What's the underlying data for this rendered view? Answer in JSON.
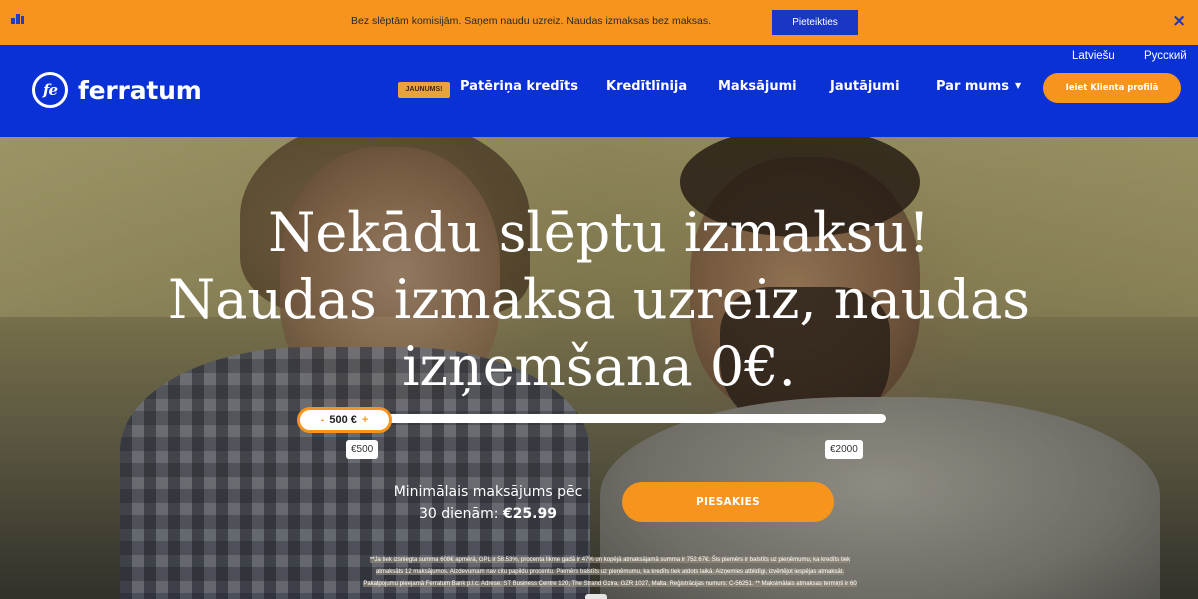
{
  "promo_bar": {
    "text": "Bez slēptām komisijām. Saņem naudu uzreiz. Naudas izmaksas bez maksas.",
    "button": "Pieteikties",
    "close": "×"
  },
  "header": {
    "logo_mark": "fe",
    "logo_text": "ferratum",
    "languages": [
      "Latviešu",
      "Русский"
    ],
    "new_badge": "JAUNUMS!",
    "nav_items": [
      "Patēriņa kredīts",
      "Kredītlīnija",
      "Maksājumi",
      "Jautājumi",
      "Par mums"
    ],
    "profile_button": "Ieiet Klienta profilā"
  },
  "hero": {
    "headline": [
      "Nekādu slēptu izmaksu!",
      "Naudas izmaksa uzreiz, naudas",
      "izņemšana 0€."
    ],
    "slider": {
      "value_label": "500 €",
      "minus": "-",
      "plus": "+",
      "min_label": "€500",
      "max_label": "€2000",
      "value": 500,
      "min": 500,
      "max": 2000
    },
    "min_payment_line1": "Minimālais maksājums pēc",
    "min_payment_line2": "30 dienām:",
    "min_payment_amount": "€25.99",
    "apply_button": "PIESAKIES",
    "disclaimer": [
      "**Ja tiek izsniegta summa 608€ apmērā, GPL ir 58.53%, procenta likme gadā ir 47% un kopējā atmaksājamā summa ir 752.67€. Šis piemērs ir balstīts uz pieņēmumu, ka kredīts tiek",
      "atmaksāts 12 maksājumos. Aizdevumam nav citu papildu procentu. Piemērs balstīts uz pieņēmumu, ka kredīts tiek atdots laikā. Aizņemies atbildīgi, izvērtējot iespējas atmaksāt.",
      "Pakalpojumu pieejamā Ferratum Bank p.l.c. Adrese: ST Business Centre 120, The Strand Gzira, GZR 1027, Malta. Reģistrācijas numurs: C-56251. **  Maksimālais atmaksas termiņš ir 60"
    ]
  },
  "colors": {
    "brand_blue": "#0a31d6",
    "accent_orange": "#f7941e",
    "button_blue": "#1a36c4"
  },
  "icons": [
    "signal-icon",
    "close-icon",
    "chevron-down-icon",
    "logo-icon"
  ]
}
